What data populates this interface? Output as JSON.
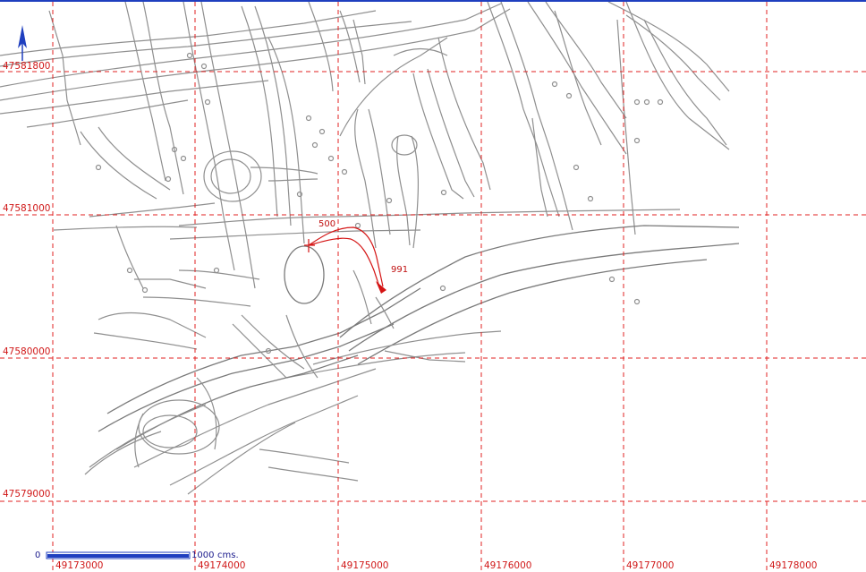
{
  "map": {
    "north_label": "N",
    "grid": {
      "y_labels": [
        "47581800",
        "47581000",
        "47580000",
        "47579000"
      ],
      "x_labels": [
        "49173000",
        "49174000",
        "49175000",
        "49176000",
        "49177000",
        "49178000"
      ]
    },
    "annotations": {
      "route_start_label": "500",
      "route_end_label": "991"
    },
    "scale_bar": {
      "start_label": "0",
      "end_label": "1000",
      "unit_label": "cms."
    },
    "colors": {
      "grid": "#e02020",
      "features": "#8f8f8f",
      "route": "#d41414",
      "scale_bar": "#1f3fbf",
      "north_arrow": "#1f3fbf"
    }
  }
}
